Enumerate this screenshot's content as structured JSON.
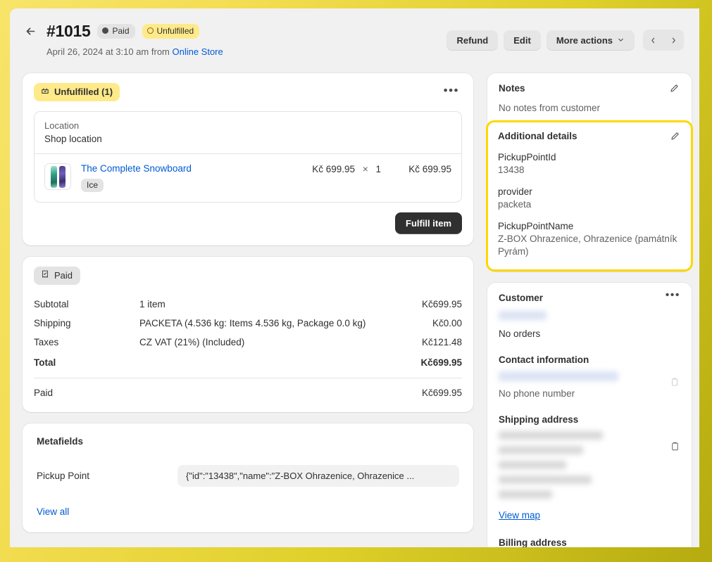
{
  "header": {
    "back_label": "←",
    "order_number": "#1015",
    "badges": [
      {
        "label": "Paid",
        "style": "gray",
        "marker": "dot-filled"
      },
      {
        "label": "Unfulfilled",
        "style": "yellow",
        "marker": "dot-ring"
      }
    ],
    "subtitle_prefix": "April 26, 2024 at 3:10 am from ",
    "source_link": "Online Store",
    "actions": {
      "refund": "Refund",
      "edit": "Edit",
      "more_actions": "More actions",
      "prev": "‹",
      "next": "›"
    }
  },
  "fulfillment": {
    "status_badge": "Unfulfilled (1)",
    "kebab": "•••",
    "location_label": "Location",
    "location_value": "Shop location",
    "line_item": {
      "title": "The Complete Snowboard",
      "variant": "Ice",
      "unit_price": "Kč 699.95",
      "multiply": "×",
      "quantity": "1",
      "line_total": "Kč 699.95"
    },
    "fulfill_button": "Fulfill item"
  },
  "payment": {
    "status_badge": "Paid",
    "rows": [
      {
        "label": "Subtotal",
        "detail": "1 item",
        "amount": "Kč699.95"
      },
      {
        "label": "Shipping",
        "detail": "PACKETA (4.536 kg: Items 4.536 kg, Package 0.0 kg)",
        "amount": "Kč0.00"
      },
      {
        "label": "Taxes",
        "detail": "CZ VAT (21%) (Included)",
        "amount": "Kč121.48"
      }
    ],
    "total": {
      "label": "Total",
      "detail": "",
      "amount": "Kč699.95"
    },
    "paid": {
      "label": "Paid",
      "amount": "Kč699.95"
    }
  },
  "metafields": {
    "title": "Metafields",
    "key": "Pickup Point",
    "value": "{\"id\":\"13438\",\"name\":\"Z-BOX Ohrazenice, Ohrazenice ...",
    "view_all": "View all"
  },
  "notes": {
    "title": "Notes",
    "empty_text": "No notes from customer"
  },
  "additional_details": {
    "title": "Additional details",
    "highlight_color": "#ffd700",
    "fields": [
      {
        "key": "PickupPointId",
        "value": "13438"
      },
      {
        "key": "provider",
        "value": "packeta"
      },
      {
        "key": "PickupPointName",
        "value": "Z-BOX Ohrazenice, Ohrazenice (památník Pyrám)"
      }
    ]
  },
  "customer": {
    "title": "Customer",
    "kebab": "•••",
    "orders_text": "No orders",
    "contact_title": "Contact information",
    "no_phone_text": "No phone number",
    "shipping_title": "Shipping address",
    "view_map": "View map",
    "billing_title": "Billing address"
  },
  "colors": {
    "accent_link": "#005bd3",
    "badge_yellow": "#ffea8a",
    "highlight_yellow": "#ffd700",
    "primary_button": "#303030",
    "page_background": "#f1f1f1"
  }
}
